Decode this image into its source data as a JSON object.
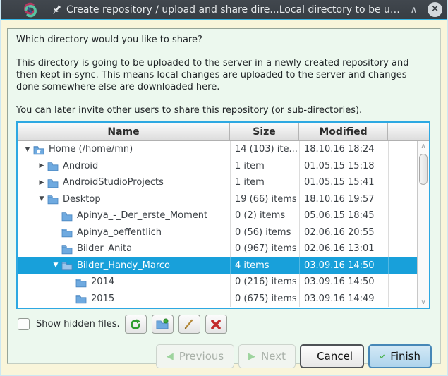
{
  "window": {
    "title": "Create repository / upload and share dire...Local directory to be uploaded and shared",
    "close_glyph": "✕",
    "shade_glyph": "∧"
  },
  "intro": {
    "question": "Which directory would you like to share?",
    "description": "This directory is going to be uploaded to the server in a newly created repository and then kept in-sync. This means local changes are uploaded to the server and changes done somewhere else are downloaded here.",
    "invite_note": "You can later invite other users to share this repository (or sub-directories)."
  },
  "tree": {
    "columns": {
      "name": "Name",
      "size": "Size",
      "modified": "Modified"
    },
    "rows": [
      {
        "name": "Home (/home/mn)",
        "size": "14 (103) ite...",
        "modified": "18.10.16 18:24",
        "level": 0,
        "expander": "open",
        "icon": "home-folder",
        "selected": false
      },
      {
        "name": "Android",
        "size": "1 item",
        "modified": "01.05.15 15:18",
        "level": 1,
        "expander": "closed",
        "icon": "folder",
        "selected": false
      },
      {
        "name": "AndroidStudioProjects",
        "size": "1 item",
        "modified": "01.05.15 15:41",
        "level": 1,
        "expander": "closed",
        "icon": "folder",
        "selected": false
      },
      {
        "name": "Desktop",
        "size": "19 (66) items",
        "modified": "18.10.16 19:57",
        "level": 1,
        "expander": "open",
        "icon": "folder",
        "selected": false
      },
      {
        "name": "Apinya_-_Der_erste_Moment",
        "size": "0 (2) items",
        "modified": "05.06.15 18:45",
        "level": 2,
        "expander": "none",
        "icon": "folder",
        "selected": false
      },
      {
        "name": "Apinya_oeffentlich",
        "size": "0 (56) items",
        "modified": "02.06.16 20:55",
        "level": 2,
        "expander": "none",
        "icon": "folder",
        "selected": false
      },
      {
        "name": "Bilder_Anita",
        "size": "0 (967) items",
        "modified": "02.06.16 13:01",
        "level": 2,
        "expander": "none",
        "icon": "folder",
        "selected": false
      },
      {
        "name": "Bilder_Handy_Marco",
        "size": "4 items",
        "modified": "03.09.16 14:50",
        "level": 2,
        "expander": "open",
        "icon": "folder",
        "selected": true
      },
      {
        "name": "2014",
        "size": "0 (216) items",
        "modified": "03.09.16 14:50",
        "level": 3,
        "expander": "none",
        "icon": "folder",
        "selected": false
      },
      {
        "name": "2015",
        "size": "0 (675) items",
        "modified": "03.09.16 14:49",
        "level": 3,
        "expander": "none",
        "icon": "folder",
        "selected": false
      }
    ],
    "expander_glyphs": {
      "open": "▼",
      "closed": "▶",
      "none": ""
    },
    "scrollbar": {
      "up_glyph": "∧",
      "down_glyph": "∨"
    }
  },
  "options": {
    "show_hidden_label": "Show hidden files."
  },
  "tool_buttons": [
    "refresh",
    "new-folder",
    "edit",
    "delete"
  ],
  "footer": {
    "previous_label": "Previous",
    "next_label": "Next",
    "cancel_label": "Cancel",
    "finish_label": "Finish",
    "prev_arrow": "◀",
    "next_arrow": "▶"
  },
  "colors": {
    "titlebar": "#3b4147",
    "titlebar_accent": "#35b4e5",
    "window_margin": "#f9f5da",
    "panel_bg": "#ecf8ee",
    "tree_focus_border": "#2da8e2",
    "selection": "#18a0da",
    "folder_blue": "#6faae0",
    "refresh_green": "#2f9e2f",
    "delete_red": "#c32b2b",
    "finish_check_green": "#46b04a"
  }
}
